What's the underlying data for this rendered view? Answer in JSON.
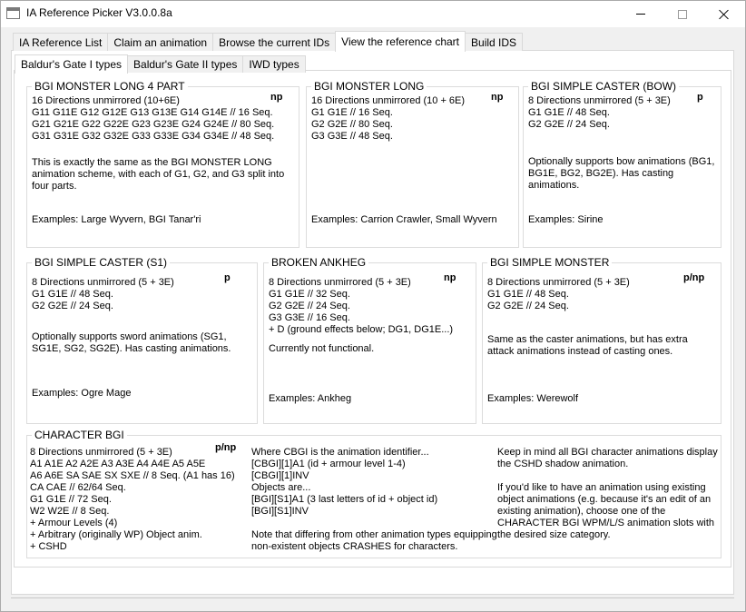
{
  "window": {
    "title": "IA Reference Picker V3.0.0.8a"
  },
  "main_tabs": [
    {
      "label": "IA Reference List"
    },
    {
      "label": "Claim an animation"
    },
    {
      "label": "Browse the current IDs"
    },
    {
      "label": "View the reference chart"
    },
    {
      "label": "Build IDS"
    }
  ],
  "sub_tabs": [
    {
      "label": "Baldur's Gate I types"
    },
    {
      "label": "Baldur's Gate II types"
    },
    {
      "label": "IWD types"
    }
  ],
  "boxes": {
    "bgi_monster_long_4_part": {
      "title": "BGI MONSTER LONG 4 PART",
      "badge": "np",
      "lines": "16 Directions unmirrored (10+6E)\nG11 G11E G12 G12E G13 G13E G14 G14E // 16 Seq.\nG21 G21E G22 G22E G23 G23E G24 G24E // 80 Seq.\nG31 G31E G32 G32E G33 G33E G34 G34E // 48 Seq.",
      "desc": "This is exactly the same as the BGI MONSTER LONG\nanimation scheme, with each of G1, G2, and G3 split into\nfour parts.",
      "examples": "Examples: Large Wyvern, BGI Tanar'ri"
    },
    "bgi_monster_long": {
      "title": "BGI MONSTER LONG",
      "badge": "np",
      "lines": "16 Directions unmirrored (10 + 6E)\nG1 G1E // 16 Seq.\nG2 G2E // 80 Seq.\nG3 G3E // 48 Seq.",
      "examples": "Examples: Carrion Crawler, Small Wyvern"
    },
    "bgi_simple_caster_bow": {
      "title": "BGI SIMPLE CASTER (BOW)",
      "badge": "p",
      "lines": "8 Directions unmirrored (5 + 3E)\nG1 G1E // 48 Seq.\nG2 G2E // 24 Seq.",
      "desc": "Optionally supports bow animations (BG1,\nBG1E, BG2, BG2E). Has casting\nanimations.",
      "examples": "Examples: Sirine"
    },
    "bgi_simple_caster_s1": {
      "title": "BGI SIMPLE CASTER (S1)",
      "badge": "p",
      "lines": "8 Directions unmirrored (5 + 3E)\nG1 G1E // 48 Seq.\nG2 G2E // 24 Seq.",
      "desc": "Optionally supports sword animations (SG1,\nSG1E, SG2, SG2E). Has casting animations.",
      "examples": "Examples: Ogre Mage"
    },
    "broken_ankheg": {
      "title": "BROKEN ANKHEG",
      "badge": "np",
      "lines": "8 Directions unmirrored (5 + 3E)\nG1 G1E // 32 Seq.\nG2 G2E // 24 Seq.\nG3 G3E // 16 Seq.\n+ D (ground effects below; DG1, DG1E...)",
      "desc": "Currently not functional.",
      "examples": "Examples: Ankheg"
    },
    "bgi_simple_monster": {
      "title": "BGI SIMPLE MONSTER",
      "badge": "p/np",
      "lines": "8 Directions unmirrored (5 + 3E)\nG1 G1E // 48 Seq.\nG2 G2E // 24 Seq.",
      "desc": "Same as the caster animations, but has extra\nattack animations instead of casting ones.",
      "examples": "Examples: Werewolf"
    },
    "character_bgi": {
      "title": "CHARACTER BGI",
      "badge": "p/np",
      "col1": "8 Directions unmirrored (5 + 3E)\nA1 A1E A2 A2E A3 A3E A4 A4E A5 A5E\nA6 A6E SA SAE SX SXE // 8 Seq. (A1 has 16)\nCA CAE // 62/64 Seq.\nG1 G1E // 72 Seq.\nW2 W2E // 8 Seq.\n+ Armour Levels (4)\n+ Arbitrary (originally WP) Object anim.\n+ CSHD",
      "col2": "Where CBGI is the animation identifier...\n[CBGI][1]A1 (id + armour level 1-4)\n[CBGI][1]INV\nObjects are...\n[BGI][S1]A1 (3 last letters of id + object id)\n[BGI][S1]INV",
      "col2_note": "Note that differing from other animation types equipping\nnon-existent objects CRASHES for characters.",
      "col3": "Keep in mind all BGI character animations display\nthe CSHD shadow animation.",
      "col3_note": "If you'd like to have an animation using existing\nobject animations (e.g. because it's an edit of an\nexisting animation), choose one of the\nCHARACTER BGI WPM/L/S animation slots with\nthe desired size category."
    }
  }
}
